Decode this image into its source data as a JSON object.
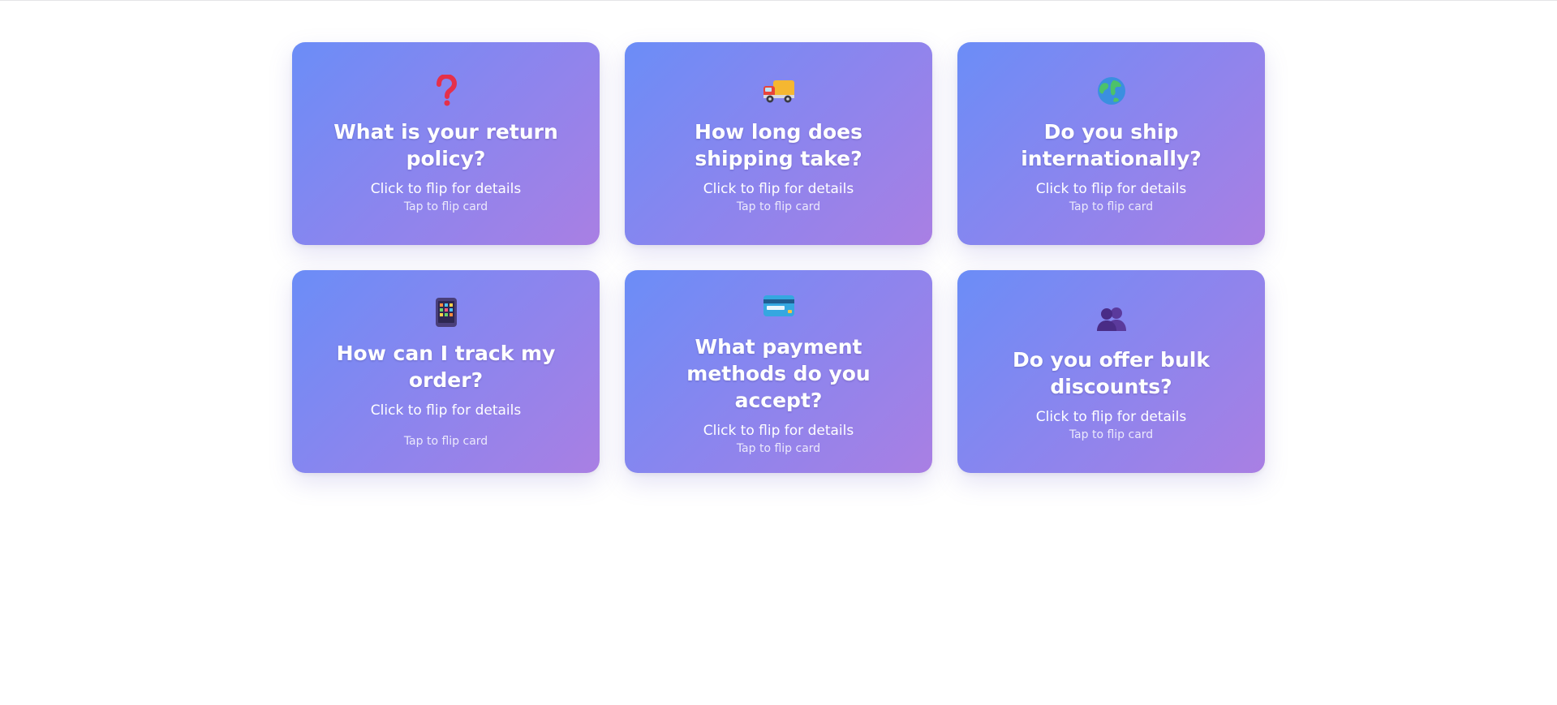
{
  "cards": [
    {
      "icon": "question-mark-icon",
      "question": "What is your return policy?",
      "hint": "Click to flip for details",
      "tap": "Tap to flip card"
    },
    {
      "icon": "delivery-truck-icon",
      "question": "How long does shipping take?",
      "hint": "Click to flip for details",
      "tap": "Tap to flip card"
    },
    {
      "icon": "globe-icon",
      "question": "Do you ship internationally?",
      "hint": "Click to flip for details",
      "tap": "Tap to flip card"
    },
    {
      "icon": "mobile-phone-icon",
      "question": "How can I track my order?",
      "hint": "Click to flip for details",
      "tap": "Tap to flip card"
    },
    {
      "icon": "credit-card-icon",
      "question": "What payment methods do you accept?",
      "hint": "Click to flip for details",
      "tap": "Tap to flip card"
    },
    {
      "icon": "people-icon",
      "question": "Do you offer bulk discounts?",
      "hint": "Click to flip for details",
      "tap": "Tap to flip card"
    }
  ],
  "colors": {
    "card_gradient_start": "#6b8df7",
    "card_gradient_end": "#a97fe3",
    "text": "#ffffff"
  }
}
